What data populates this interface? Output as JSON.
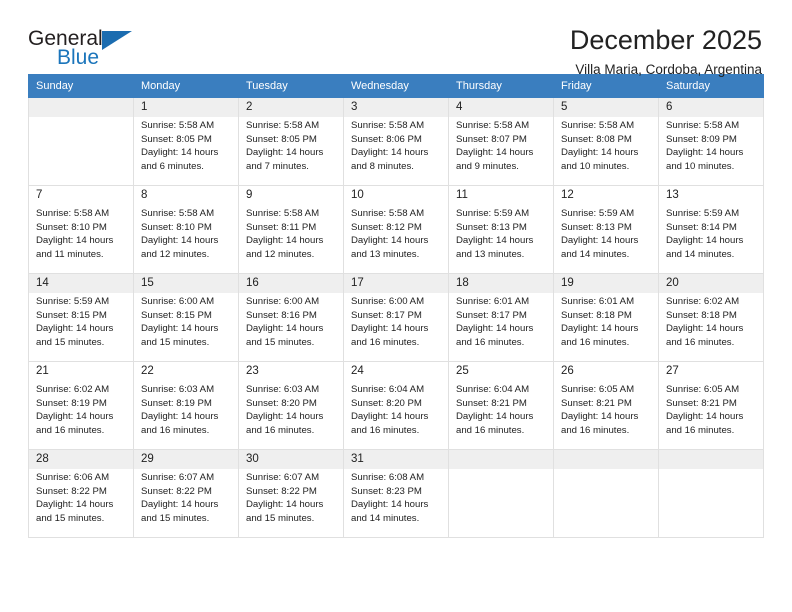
{
  "brand": {
    "name_top": "General",
    "name_bottom": "Blue",
    "triangle_color": "#1b6cb0",
    "blue_color": "#1b75bb"
  },
  "header": {
    "title": "December 2025",
    "subtitle": "Villa Maria, Cordoba, Argentina"
  },
  "theme": {
    "header_bg": "#3a7ebf",
    "header_text": "#ffffff",
    "row_shade": "#efefef",
    "grid_border": "#e0e0e0"
  },
  "weekdays": [
    "Sunday",
    "Monday",
    "Tuesday",
    "Wednesday",
    "Thursday",
    "Friday",
    "Saturday"
  ],
  "weeks": [
    [
      {
        "day": "",
        "sunrise": "",
        "sunset": "",
        "daylight1": "",
        "daylight2": ""
      },
      {
        "day": "1",
        "sunrise": "Sunrise: 5:58 AM",
        "sunset": "Sunset: 8:05 PM",
        "daylight1": "Daylight: 14 hours",
        "daylight2": "and 6 minutes."
      },
      {
        "day": "2",
        "sunrise": "Sunrise: 5:58 AM",
        "sunset": "Sunset: 8:05 PM",
        "daylight1": "Daylight: 14 hours",
        "daylight2": "and 7 minutes."
      },
      {
        "day": "3",
        "sunrise": "Sunrise: 5:58 AM",
        "sunset": "Sunset: 8:06 PM",
        "daylight1": "Daylight: 14 hours",
        "daylight2": "and 8 minutes."
      },
      {
        "day": "4",
        "sunrise": "Sunrise: 5:58 AM",
        "sunset": "Sunset: 8:07 PM",
        "daylight1": "Daylight: 14 hours",
        "daylight2": "and 9 minutes."
      },
      {
        "day": "5",
        "sunrise": "Sunrise: 5:58 AM",
        "sunset": "Sunset: 8:08 PM",
        "daylight1": "Daylight: 14 hours",
        "daylight2": "and 10 minutes."
      },
      {
        "day": "6",
        "sunrise": "Sunrise: 5:58 AM",
        "sunset": "Sunset: 8:09 PM",
        "daylight1": "Daylight: 14 hours",
        "daylight2": "and 10 minutes."
      }
    ],
    [
      {
        "day": "7",
        "sunrise": "Sunrise: 5:58 AM",
        "sunset": "Sunset: 8:10 PM",
        "daylight1": "Daylight: 14 hours",
        "daylight2": "and 11 minutes."
      },
      {
        "day": "8",
        "sunrise": "Sunrise: 5:58 AM",
        "sunset": "Sunset: 8:10 PM",
        "daylight1": "Daylight: 14 hours",
        "daylight2": "and 12 minutes."
      },
      {
        "day": "9",
        "sunrise": "Sunrise: 5:58 AM",
        "sunset": "Sunset: 8:11 PM",
        "daylight1": "Daylight: 14 hours",
        "daylight2": "and 12 minutes."
      },
      {
        "day": "10",
        "sunrise": "Sunrise: 5:58 AM",
        "sunset": "Sunset: 8:12 PM",
        "daylight1": "Daylight: 14 hours",
        "daylight2": "and 13 minutes."
      },
      {
        "day": "11",
        "sunrise": "Sunrise: 5:59 AM",
        "sunset": "Sunset: 8:13 PM",
        "daylight1": "Daylight: 14 hours",
        "daylight2": "and 13 minutes."
      },
      {
        "day": "12",
        "sunrise": "Sunrise: 5:59 AM",
        "sunset": "Sunset: 8:13 PM",
        "daylight1": "Daylight: 14 hours",
        "daylight2": "and 14 minutes."
      },
      {
        "day": "13",
        "sunrise": "Sunrise: 5:59 AM",
        "sunset": "Sunset: 8:14 PM",
        "daylight1": "Daylight: 14 hours",
        "daylight2": "and 14 minutes."
      }
    ],
    [
      {
        "day": "14",
        "sunrise": "Sunrise: 5:59 AM",
        "sunset": "Sunset: 8:15 PM",
        "daylight1": "Daylight: 14 hours",
        "daylight2": "and 15 minutes."
      },
      {
        "day": "15",
        "sunrise": "Sunrise: 6:00 AM",
        "sunset": "Sunset: 8:15 PM",
        "daylight1": "Daylight: 14 hours",
        "daylight2": "and 15 minutes."
      },
      {
        "day": "16",
        "sunrise": "Sunrise: 6:00 AM",
        "sunset": "Sunset: 8:16 PM",
        "daylight1": "Daylight: 14 hours",
        "daylight2": "and 15 minutes."
      },
      {
        "day": "17",
        "sunrise": "Sunrise: 6:00 AM",
        "sunset": "Sunset: 8:17 PM",
        "daylight1": "Daylight: 14 hours",
        "daylight2": "and 16 minutes."
      },
      {
        "day": "18",
        "sunrise": "Sunrise: 6:01 AM",
        "sunset": "Sunset: 8:17 PM",
        "daylight1": "Daylight: 14 hours",
        "daylight2": "and 16 minutes."
      },
      {
        "day": "19",
        "sunrise": "Sunrise: 6:01 AM",
        "sunset": "Sunset: 8:18 PM",
        "daylight1": "Daylight: 14 hours",
        "daylight2": "and 16 minutes."
      },
      {
        "day": "20",
        "sunrise": "Sunrise: 6:02 AM",
        "sunset": "Sunset: 8:18 PM",
        "daylight1": "Daylight: 14 hours",
        "daylight2": "and 16 minutes."
      }
    ],
    [
      {
        "day": "21",
        "sunrise": "Sunrise: 6:02 AM",
        "sunset": "Sunset: 8:19 PM",
        "daylight1": "Daylight: 14 hours",
        "daylight2": "and 16 minutes."
      },
      {
        "day": "22",
        "sunrise": "Sunrise: 6:03 AM",
        "sunset": "Sunset: 8:19 PM",
        "daylight1": "Daylight: 14 hours",
        "daylight2": "and 16 minutes."
      },
      {
        "day": "23",
        "sunrise": "Sunrise: 6:03 AM",
        "sunset": "Sunset: 8:20 PM",
        "daylight1": "Daylight: 14 hours",
        "daylight2": "and 16 minutes."
      },
      {
        "day": "24",
        "sunrise": "Sunrise: 6:04 AM",
        "sunset": "Sunset: 8:20 PM",
        "daylight1": "Daylight: 14 hours",
        "daylight2": "and 16 minutes."
      },
      {
        "day": "25",
        "sunrise": "Sunrise: 6:04 AM",
        "sunset": "Sunset: 8:21 PM",
        "daylight1": "Daylight: 14 hours",
        "daylight2": "and 16 minutes."
      },
      {
        "day": "26",
        "sunrise": "Sunrise: 6:05 AM",
        "sunset": "Sunset: 8:21 PM",
        "daylight1": "Daylight: 14 hours",
        "daylight2": "and 16 minutes."
      },
      {
        "day": "27",
        "sunrise": "Sunrise: 6:05 AM",
        "sunset": "Sunset: 8:21 PM",
        "daylight1": "Daylight: 14 hours",
        "daylight2": "and 16 minutes."
      }
    ],
    [
      {
        "day": "28",
        "sunrise": "Sunrise: 6:06 AM",
        "sunset": "Sunset: 8:22 PM",
        "daylight1": "Daylight: 14 hours",
        "daylight2": "and 15 minutes."
      },
      {
        "day": "29",
        "sunrise": "Sunrise: 6:07 AM",
        "sunset": "Sunset: 8:22 PM",
        "daylight1": "Daylight: 14 hours",
        "daylight2": "and 15 minutes."
      },
      {
        "day": "30",
        "sunrise": "Sunrise: 6:07 AM",
        "sunset": "Sunset: 8:22 PM",
        "daylight1": "Daylight: 14 hours",
        "daylight2": "and 15 minutes."
      },
      {
        "day": "31",
        "sunrise": "Sunrise: 6:08 AM",
        "sunset": "Sunset: 8:23 PM",
        "daylight1": "Daylight: 14 hours",
        "daylight2": "and 14 minutes."
      },
      {
        "day": "",
        "sunrise": "",
        "sunset": "",
        "daylight1": "",
        "daylight2": ""
      },
      {
        "day": "",
        "sunrise": "",
        "sunset": "",
        "daylight1": "",
        "daylight2": ""
      },
      {
        "day": "",
        "sunrise": "",
        "sunset": "",
        "daylight1": "",
        "daylight2": ""
      }
    ]
  ]
}
